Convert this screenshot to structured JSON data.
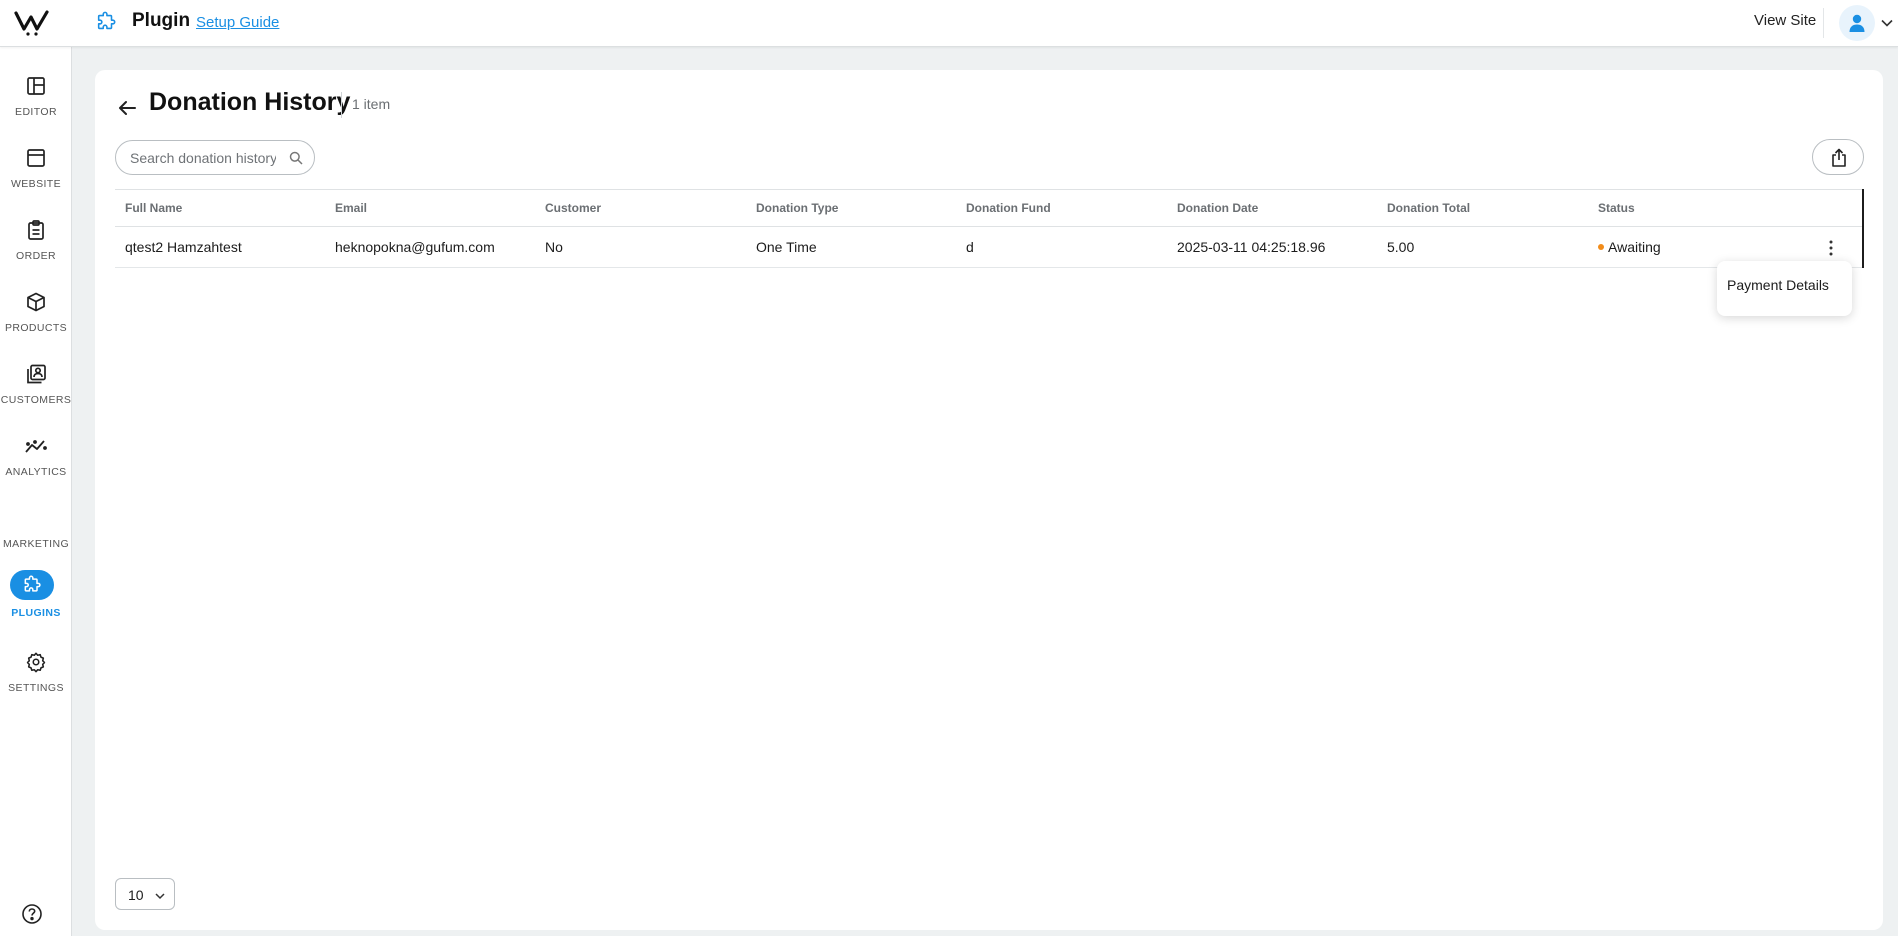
{
  "header": {
    "title": "Plugin",
    "setup_link": "Setup Guide",
    "view_site": "View Site"
  },
  "sidebar": {
    "items": [
      {
        "label": "EDITOR",
        "icon": "editor-icon"
      },
      {
        "label": "WEBSITE",
        "icon": "website-icon"
      },
      {
        "label": "ORDER",
        "icon": "order-icon"
      },
      {
        "label": "PRODUCTS",
        "icon": "products-icon"
      },
      {
        "label": "CUSTOMERS",
        "icon": "customers-icon"
      },
      {
        "label": "ANALYTICS",
        "icon": "analytics-icon"
      },
      {
        "label": "MARKETING",
        "icon": ""
      },
      {
        "label": "PLUGINS",
        "icon": "puzzle-icon",
        "active": true
      },
      {
        "label": "SETTINGS",
        "icon": "gear-icon"
      }
    ]
  },
  "page": {
    "title": "Donation History",
    "count": "1 item"
  },
  "search": {
    "placeholder": "Search donation history",
    "value": ""
  },
  "table": {
    "columns": [
      "Full Name",
      "Email",
      "Customer",
      "Donation Type",
      "Donation Fund",
      "Donation Date",
      "Donation Total",
      "Status"
    ],
    "rows": [
      {
        "full_name": "qtest2 Hamzahtest",
        "email": "heknopokna@gufum.com",
        "customer": "No",
        "donation_type": "One Time",
        "donation_fund": "d",
        "donation_date": "2025-03-11 04:25:18.96",
        "donation_total": "5.00",
        "status": "Awaiting"
      }
    ]
  },
  "row_menu": {
    "items": [
      "Payment Details"
    ]
  },
  "pagination": {
    "page_size": "10"
  },
  "colors": {
    "accent": "#1a8fe3",
    "status_awaiting": "#f28c1a",
    "background": "#eef1f2"
  }
}
